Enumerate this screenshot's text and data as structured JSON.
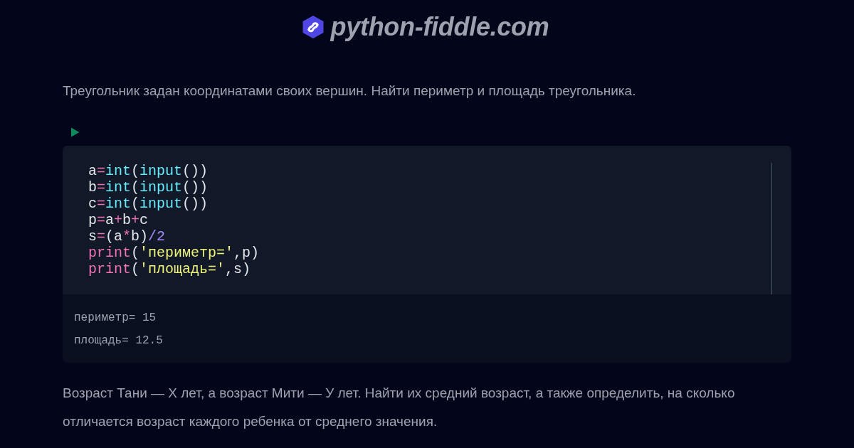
{
  "header": {
    "site_name": "python-fiddle.com"
  },
  "sections": [
    {
      "prompt": "Треугольник задан координатами своих вершин. Найти периметр и площадь треугольника.",
      "code": {
        "lines": [
          [
            {
              "kind": "name",
              "text": "a"
            },
            {
              "kind": "operator",
              "text": "="
            },
            {
              "kind": "builtin",
              "text": "int"
            },
            {
              "kind": "punctuation",
              "text": "("
            },
            {
              "kind": "builtin",
              "text": "input"
            },
            {
              "kind": "punctuation",
              "text": "())"
            }
          ],
          [
            {
              "kind": "name",
              "text": "b"
            },
            {
              "kind": "operator",
              "text": "="
            },
            {
              "kind": "builtin",
              "text": "int"
            },
            {
              "kind": "punctuation",
              "text": "("
            },
            {
              "kind": "builtin",
              "text": "input"
            },
            {
              "kind": "punctuation",
              "text": "())"
            }
          ],
          [
            {
              "kind": "name",
              "text": "c"
            },
            {
              "kind": "operator",
              "text": "="
            },
            {
              "kind": "builtin",
              "text": "int"
            },
            {
              "kind": "punctuation",
              "text": "("
            },
            {
              "kind": "builtin",
              "text": "input"
            },
            {
              "kind": "punctuation",
              "text": "())"
            }
          ],
          [
            {
              "kind": "name",
              "text": "p"
            },
            {
              "kind": "operator",
              "text": "="
            },
            {
              "kind": "name",
              "text": "a"
            },
            {
              "kind": "operator",
              "text": "+"
            },
            {
              "kind": "name",
              "text": "b"
            },
            {
              "kind": "operator",
              "text": "+"
            },
            {
              "kind": "name",
              "text": "c"
            }
          ],
          [
            {
              "kind": "name",
              "text": "s"
            },
            {
              "kind": "operator",
              "text": "="
            },
            {
              "kind": "punctuation",
              "text": "(a"
            },
            {
              "kind": "operator",
              "text": "*"
            },
            {
              "kind": "punctuation",
              "text": "b)"
            },
            {
              "kind": "slash",
              "text": "/"
            },
            {
              "kind": "number",
              "text": "2"
            }
          ],
          [
            {
              "kind": "keyword",
              "text": "print"
            },
            {
              "kind": "punctuation",
              "text": "("
            },
            {
              "kind": "string",
              "text": "'периметр='"
            },
            {
              "kind": "punctuation",
              "text": ",p)"
            }
          ],
          [
            {
              "kind": "keyword",
              "text": "print"
            },
            {
              "kind": "punctuation",
              "text": "("
            },
            {
              "kind": "string",
              "text": "'площадь='"
            },
            {
              "kind": "punctuation",
              "text": ",s)"
            }
          ]
        ]
      },
      "output": [
        "периметр= 15",
        "площадь= 12.5"
      ]
    },
    {
      "prompt": "Возраст Тани — X лет, а возраст Мити — У лет. Найти их средний возраст, а также определить, на сколько отличается возраст каждого ребенка от среднего значения."
    }
  ]
}
